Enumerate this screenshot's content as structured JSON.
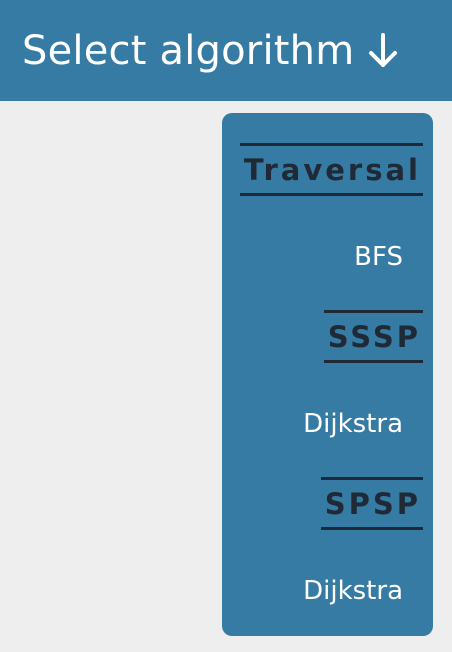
{
  "header": {
    "title": "Select algorithm",
    "icon": "arrow-down-icon",
    "background": "#367ba3"
  },
  "menu": {
    "background": "#367ba3",
    "label_color": "#1f2a36",
    "groups": [
      {
        "label": "Traversal",
        "items": [
          "BFS"
        ]
      },
      {
        "label": "SSSP",
        "items": [
          "Dijkstra"
        ]
      },
      {
        "label": "SPSP",
        "items": [
          "Dijkstra"
        ]
      }
    ]
  }
}
